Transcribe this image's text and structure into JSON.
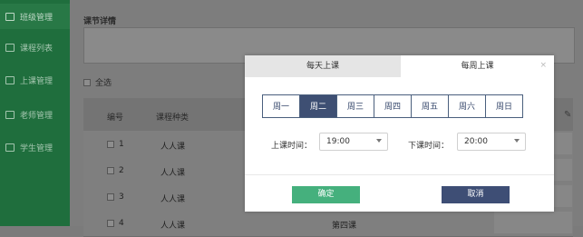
{
  "sidebar": {
    "items": [
      {
        "label": "班级管理",
        "icon": "calendar-icon"
      },
      {
        "label": "课程列表",
        "icon": "book-icon"
      },
      {
        "label": "上课管理",
        "icon": "list-icon"
      },
      {
        "label": "老师管理",
        "icon": "user-icon"
      },
      {
        "label": "学生管理",
        "icon": "users-icon"
      }
    ]
  },
  "background": {
    "section_title": "课节详情",
    "select_all": "全选",
    "columns": [
      "编号",
      "课程种类"
    ],
    "rows": [
      {
        "num": "1",
        "type": "人人课",
        "section": ""
      },
      {
        "num": "2",
        "type": "人人课",
        "section": ""
      },
      {
        "num": "3",
        "type": "人人课",
        "section": ""
      },
      {
        "num": "4",
        "type": "人人课",
        "section": "第四课"
      }
    ]
  },
  "modal": {
    "tabs": [
      "每天上课",
      "每周上课"
    ],
    "active_tab": 1,
    "close": "×",
    "days": [
      "周一",
      "周二",
      "周三",
      "周四",
      "周五",
      "周六",
      "周日"
    ],
    "selected_day": 1,
    "start_label": "上课时间：",
    "start_value": "19:00",
    "end_label": "下课时间：",
    "end_value": "20:00",
    "confirm": "确定",
    "cancel": "取消"
  },
  "colors": {
    "sidebar": "#1f6e3d",
    "primary": "#3e4f73",
    "confirm": "#45b07d"
  }
}
